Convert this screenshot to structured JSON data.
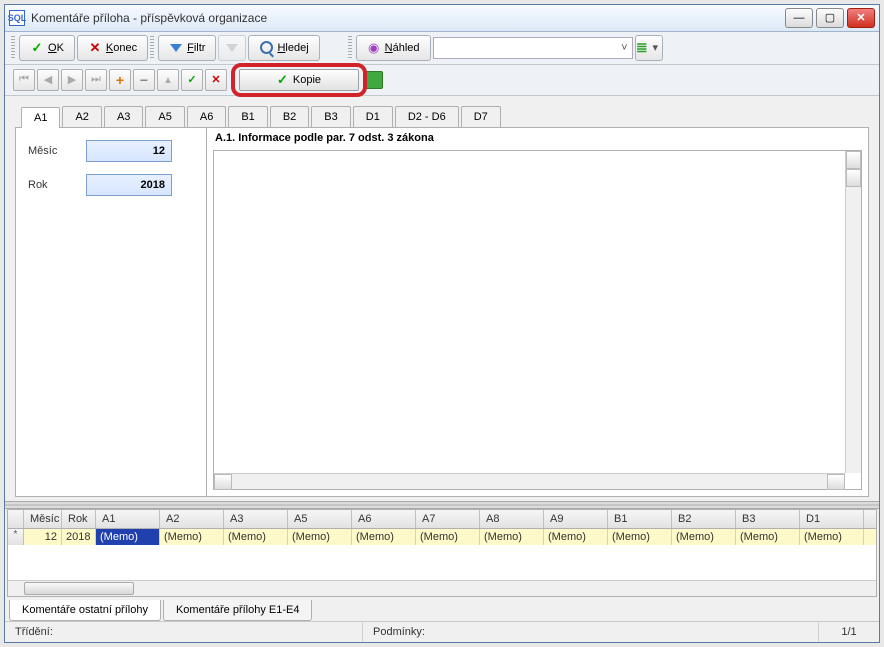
{
  "window": {
    "icon_text": "SQL",
    "title": "Komentáře příloha - příspěvková organizace"
  },
  "toolbar1": {
    "ok": "OK",
    "ok_letter": "O",
    "ok_rest": "K",
    "konec": "Konec",
    "konec_letter": "K",
    "konec_rest": "onec",
    "filtr": "Filtr",
    "filtr_letter": "F",
    "filtr_rest": "iltr",
    "hledej": "Hledej",
    "hledej_letter": "H",
    "hledej_rest": "ledej",
    "nahled": "Náhled",
    "nahled_letter": "N",
    "nahled_rest": "áhled"
  },
  "toolbar2": {
    "kopie": "Kopie"
  },
  "tabs": [
    "A1",
    "A2",
    "A3",
    "A5",
    "A6",
    "B1",
    "B2",
    "B3",
    "D1",
    "D2 - D6",
    "D7"
  ],
  "form": {
    "mesic_label": "Měsíc",
    "rok_label": "Rok",
    "mesic_value": "12",
    "rok_value": "2018",
    "section_title": "A.1. Informace podle par. 7 odst. 3 zákona"
  },
  "grid": {
    "columns": [
      "Měsíc",
      "Rok",
      "A1",
      "A2",
      "A3",
      "A5",
      "A6",
      "A7",
      "A8",
      "A9",
      "B1",
      "B2",
      "B3",
      "D1"
    ],
    "row_marker": "*",
    "row": {
      "mesic": "12",
      "rok": "2018",
      "cells": [
        "(Memo)",
        "(Memo)",
        "(Memo)",
        "(Memo)",
        "(Memo)",
        "(Memo)",
        "(Memo)",
        "(Memo)",
        "(Memo)",
        "(Memo)",
        "(Memo)",
        "(Memo)"
      ]
    }
  },
  "lower_tabs": [
    "Komentáře ostatní přílohy",
    "Komentáře přílohy E1-E4"
  ],
  "status": {
    "sort_label": "Třídění:",
    "cond_label": "Podmínky:",
    "page": "1/1"
  }
}
